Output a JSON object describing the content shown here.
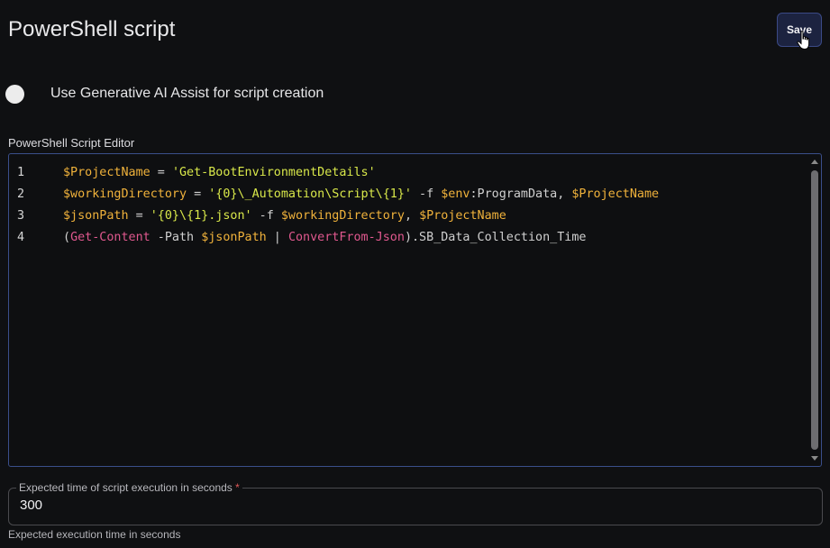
{
  "header": {
    "title": "PowerShell script",
    "save_label": "Save"
  },
  "ai_assist": {
    "label": "Use Generative AI Assist for script creation",
    "enabled": false
  },
  "editor": {
    "label": "PowerShell Script Editor",
    "lines": [
      {
        "number": "1",
        "tokens": [
          {
            "text": "$ProjectName",
            "kind": "variable"
          },
          {
            "text": " = ",
            "kind": "operator"
          },
          {
            "text": "'Get-BootEnvironmentDetails'",
            "kind": "string"
          }
        ]
      },
      {
        "number": "2",
        "tokens": [
          {
            "text": "$workingDirectory",
            "kind": "variable"
          },
          {
            "text": " = ",
            "kind": "operator"
          },
          {
            "text": "'{0}\\_Automation\\Script\\{1}'",
            "kind": "string"
          },
          {
            "text": " -f ",
            "kind": "operator"
          },
          {
            "text": "$env",
            "kind": "variable"
          },
          {
            "text": ":ProgramData, ",
            "kind": "operator"
          },
          {
            "text": "$ProjectName",
            "kind": "variable"
          }
        ]
      },
      {
        "number": "3",
        "tokens": [
          {
            "text": "$jsonPath",
            "kind": "variable"
          },
          {
            "text": " = ",
            "kind": "operator"
          },
          {
            "text": "'{0}\\{1}.json'",
            "kind": "string"
          },
          {
            "text": " -f ",
            "kind": "operator"
          },
          {
            "text": "$workingDirectory",
            "kind": "variable"
          },
          {
            "text": ", ",
            "kind": "operator"
          },
          {
            "text": "$ProjectName",
            "kind": "variable"
          }
        ]
      },
      {
        "number": "4",
        "tokens": [
          {
            "text": "(",
            "kind": "operator"
          },
          {
            "text": "Get-Content",
            "kind": "command"
          },
          {
            "text": " -Path ",
            "kind": "operator"
          },
          {
            "text": "$jsonPath",
            "kind": "variable"
          },
          {
            "text": " | ",
            "kind": "operator"
          },
          {
            "text": "ConvertFrom-Json",
            "kind": "command"
          },
          {
            "text": ").SB_Data_Collection_Time",
            "kind": "operator"
          }
        ]
      }
    ]
  },
  "execution_time": {
    "label": "Expected time of script execution in seconds",
    "required_mark": "*",
    "value": "300",
    "helper": "Expected execution time in seconds"
  },
  "colors": {
    "accent_border": "#3a4f8a",
    "save_bg": "#1c2340",
    "variable": "#f0b23b",
    "string": "#d9e84a",
    "command": "#e0588e"
  }
}
